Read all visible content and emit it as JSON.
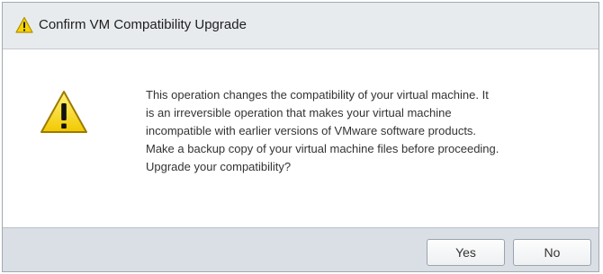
{
  "dialog": {
    "title": "Confirm VM Compatibility Upgrade",
    "title_icon": "warning-icon",
    "body_icon": "warning-icon",
    "message_lines": [
      "This operation changes the compatibility of your virtual machine. It",
      "is an irreversible operation that makes your virtual machine",
      "incompatible with earlier versions of VMware software products.",
      "Make a backup copy of your virtual machine files before proceeding.",
      "Upgrade your compatibility?"
    ],
    "buttons": {
      "yes_label": "Yes",
      "no_label": "No"
    }
  },
  "colors": {
    "warning_fill": "#f5d400",
    "warning_stroke": "#b38f00",
    "titlebar_bg": "#e8ebee",
    "footer_bg": "#d9dfe5"
  }
}
